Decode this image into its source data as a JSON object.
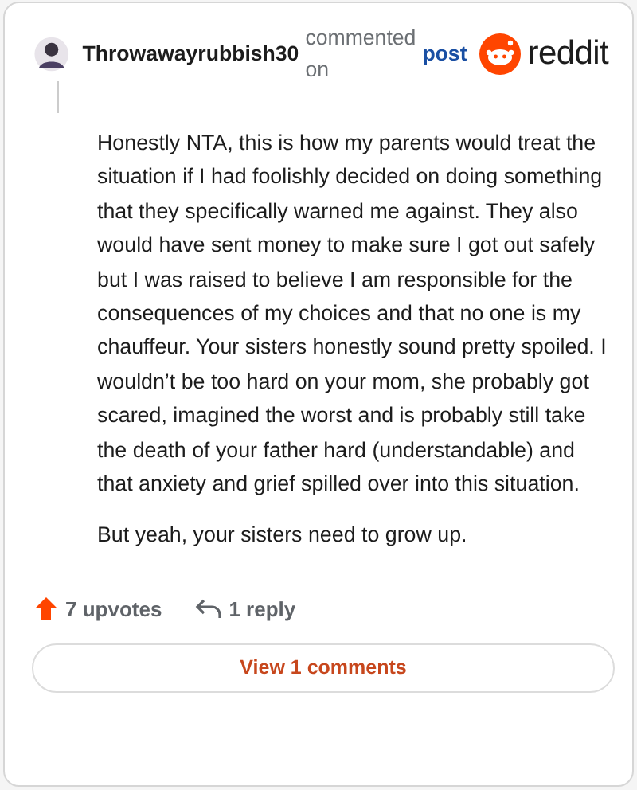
{
  "header": {
    "username": "Throwawayrubbish30",
    "action": "commented on",
    "link": "post",
    "brand": "reddit"
  },
  "body": [
    "Honestly NTA, this is how my parents would treat the situation if I had foolishly decided on doing something that they specifically warned me against. They also would have sent money to make sure I got out safely but I was raised to believe I am responsible for the consequences of my choices and that no one is my chauffeur. Your sisters honestly sound pretty spoiled. I wouldn’t be too hard on your mom, she probably got scared, imagined the worst and is probably still take the death of your father hard (understandable) and that anxiety and grief spilled over into this situation.",
    "But yeah, your sisters need to grow up."
  ],
  "footer": {
    "upvotes": "7 upvotes",
    "replies": "1 reply",
    "view_button": "View 1 comments"
  }
}
